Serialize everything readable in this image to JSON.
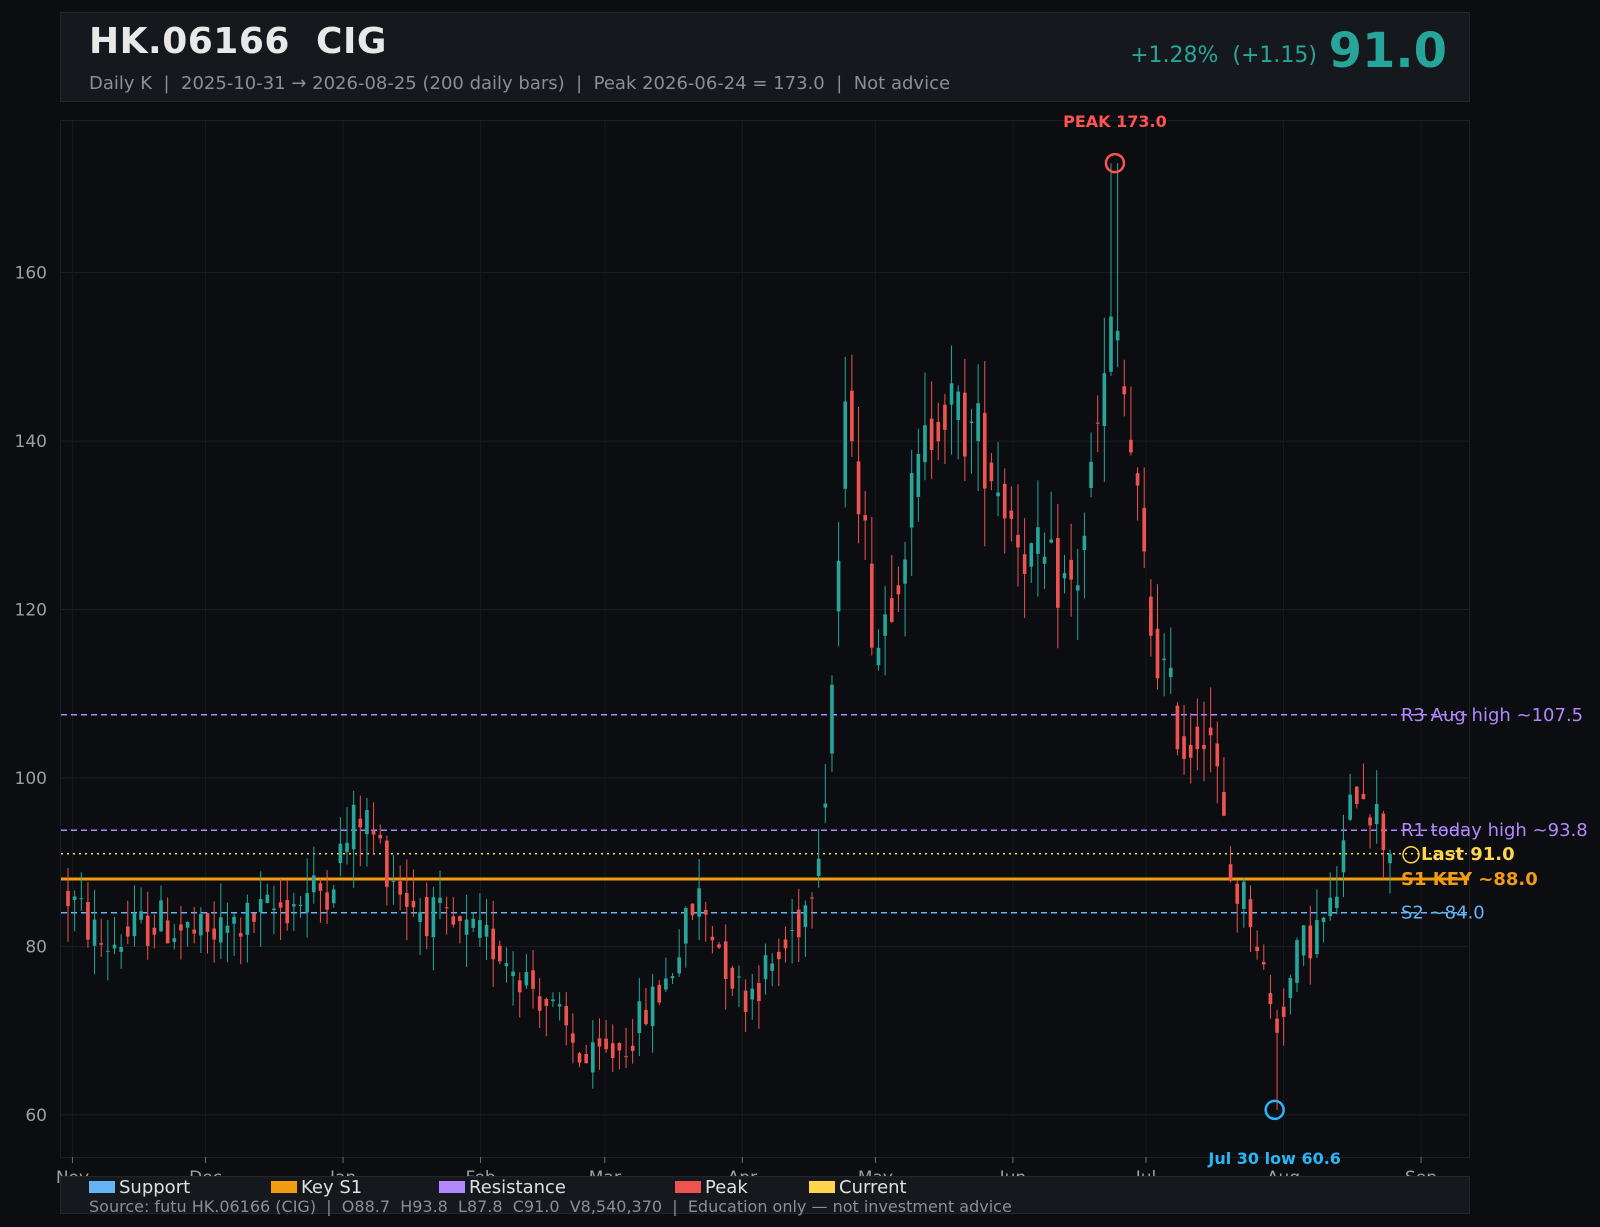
{
  "header": {
    "symbol": "HK.06166",
    "name": "CIG",
    "subtitle": "Daily K  |  2025-10-31 → 2026-08-25 (200 daily bars)  |  Peak 2026-06-24 = 173.0  |  Not advice",
    "change_pct": "+1.28%",
    "change_abs": "(+1.15)",
    "last_price": "91.0"
  },
  "colors": {
    "up": "#26a69a",
    "down": "#ef5350",
    "support": "#64b5f6",
    "key_support": "#f39c12",
    "resistance": "#b388ff",
    "peak": "#ff5252",
    "current": "#ffd54f",
    "low_marker": "#29b6f6"
  },
  "chart_data": {
    "type": "candlestick",
    "x_start": "2025-10-31",
    "x_end": "2026-08-25",
    "bar_count": 200,
    "ylim": [
      55,
      178
    ],
    "y_ticks": [
      60,
      80,
      100,
      120,
      140,
      160
    ],
    "x_tick_labels": [
      "Nov",
      "Dec",
      "Jan",
      "Feb",
      "Mar",
      "Apr",
      "May",
      "Jun",
      "Jul",
      "Aug",
      "Sep"
    ],
    "grid": true,
    "peak": {
      "label": "PEAK 173.0",
      "date": "2026-06-24",
      "value": 173.0
    },
    "low": {
      "label": "Jul 30 low 60.6",
      "date": "2026-07-30",
      "value": 60.6
    },
    "levels": [
      {
        "label": "R3 Aug high ~107.5",
        "value": 107.5,
        "kind": "resistance"
      },
      {
        "label": "R1 today high ~93.8",
        "value": 93.8,
        "kind": "resistance"
      },
      {
        "label": "Last 91.0",
        "value": 91.0,
        "kind": "current"
      },
      {
        "label": "S1 KEY ~88.0",
        "value": 88.0,
        "kind": "key_support"
      },
      {
        "label": "S2 ~84.0",
        "value": 84.0,
        "kind": "support"
      }
    ],
    "price_path": [
      {
        "date": "2025-10-31",
        "value": 86
      },
      {
        "date": "2025-11-08",
        "value": 80
      },
      {
        "date": "2025-11-20",
        "value": 83
      },
      {
        "date": "2025-12-01",
        "value": 81
      },
      {
        "date": "2025-12-15",
        "value": 84
      },
      {
        "date": "2025-12-28",
        "value": 87
      },
      {
        "date": "2026-01-05",
        "value": 96
      },
      {
        "date": "2026-01-15",
        "value": 86
      },
      {
        "date": "2026-01-25",
        "value": 82
      },
      {
        "date": "2026-02-05",
        "value": 80
      },
      {
        "date": "2026-02-15",
        "value": 74
      },
      {
        "date": "2026-02-25",
        "value": 66
      },
      {
        "date": "2026-03-05",
        "value": 68
      },
      {
        "date": "2026-03-15",
        "value": 76
      },
      {
        "date": "2026-03-22",
        "value": 86
      },
      {
        "date": "2026-04-01",
        "value": 74
      },
      {
        "date": "2026-04-10",
        "value": 79
      },
      {
        "date": "2026-04-16",
        "value": 86
      },
      {
        "date": "2026-04-20",
        "value": 100
      },
      {
        "date": "2026-04-25",
        "value": 148
      },
      {
        "date": "2026-05-01",
        "value": 115
      },
      {
        "date": "2026-05-08",
        "value": 130
      },
      {
        "date": "2026-05-15",
        "value": 145
      },
      {
        "date": "2026-05-25",
        "value": 140
      },
      {
        "date": "2026-06-05",
        "value": 126
      },
      {
        "date": "2026-06-15",
        "value": 122
      },
      {
        "date": "2026-06-24",
        "value": 155
      },
      {
        "date": "2026-07-02",
        "value": 118
      },
      {
        "date": "2026-07-10",
        "value": 103
      },
      {
        "date": "2026-07-15",
        "value": 108
      },
      {
        "date": "2026-07-20",
        "value": 88
      },
      {
        "date": "2026-07-25",
        "value": 84
      },
      {
        "date": "2026-07-30",
        "value": 70
      },
      {
        "date": "2026-08-05",
        "value": 80
      },
      {
        "date": "2026-08-12",
        "value": 84
      },
      {
        "date": "2026-08-18",
        "value": 101
      },
      {
        "date": "2026-08-25",
        "value": 91
      }
    ]
  },
  "legend": [
    {
      "label": "Support",
      "color": "#64b5f6"
    },
    {
      "label": "Key S1",
      "color": "#f39c12"
    },
    {
      "label": "Resistance",
      "color": "#b388ff"
    },
    {
      "label": "Peak",
      "color": "#ef5350"
    },
    {
      "label": "Current",
      "color": "#ffd54f"
    }
  ],
  "footer": {
    "source": "Source: futu HK.06166 (CIG)  |  O88.7  H93.8  L87.8  C91.0  V8,540,370  |  Education only — not investment advice"
  }
}
